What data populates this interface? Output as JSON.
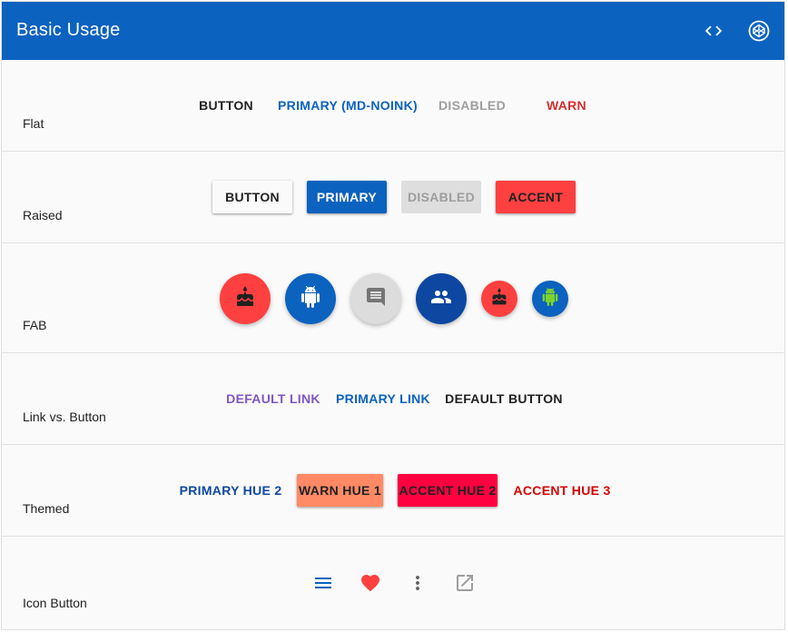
{
  "toolbar": {
    "title": "Basic Usage",
    "icons": [
      "code-icon",
      "codepen-icon"
    ],
    "background": "#0b62bf"
  },
  "sections": {
    "flat": {
      "label": "Flat",
      "buttons": [
        "BUTTON",
        "PRIMARY (MD-NOINK)",
        "DISABLED",
        "WARN"
      ]
    },
    "raised": {
      "label": "Raised",
      "buttons": [
        "BUTTON",
        "PRIMARY",
        "DISABLED",
        "ACCENT"
      ]
    },
    "fab": {
      "label": "FAB",
      "buttons": [
        "cake-icon",
        "android-icon",
        "comment-icon",
        "people-icon",
        "cake-icon",
        "android-icon"
      ]
    },
    "link": {
      "label": "Link vs. Button",
      "buttons": [
        "DEFAULT LINK",
        "PRIMARY LINK",
        "DEFAULT BUTTON"
      ]
    },
    "themed": {
      "label": "Themed",
      "buttons": [
        "PRIMARY HUE 2",
        "WARN HUE 1",
        "ACCENT HUE 2",
        "ACCENT HUE 3"
      ]
    },
    "icon": {
      "label": "Icon Button",
      "buttons": [
        "menu-icon",
        "heart-icon",
        "more-vert-icon",
        "open-in-new-icon"
      ]
    }
  },
  "colors": {
    "primary": "#0b62bf",
    "accent": "#ff4040",
    "warn": "#d32f2f",
    "disabled": "#9e9e9e",
    "link_purple": "#7e57c2",
    "primary_hue2": "#0d47a1",
    "warn_hue1": "#ff8a65",
    "accent_hue2": "#ff0040",
    "accent_hue3": "#d50000"
  }
}
